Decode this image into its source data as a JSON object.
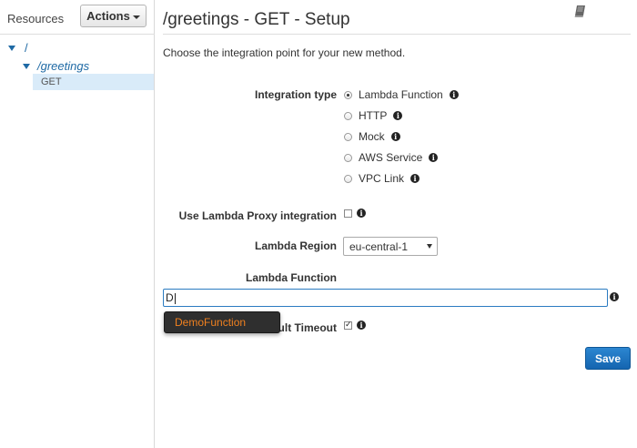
{
  "sidebar": {
    "resources_label": "Resources",
    "actions_label": "Actions",
    "tree": {
      "root": "/",
      "child": "/greetings",
      "method": "GET"
    }
  },
  "header": {
    "title": "/greetings - GET - Setup"
  },
  "intro_text": "Choose the integration point for your new method.",
  "integration_type": {
    "label": "Integration type",
    "options": [
      {
        "label": "Lambda Function",
        "selected": true
      },
      {
        "label": "HTTP",
        "selected": false
      },
      {
        "label": "Mock",
        "selected": false
      },
      {
        "label": "AWS Service",
        "selected": false
      },
      {
        "label": "VPC Link",
        "selected": false
      }
    ]
  },
  "proxy": {
    "label": "Use Lambda Proxy integration",
    "checked": false
  },
  "region": {
    "label": "Lambda Region",
    "value": "eu-central-1"
  },
  "lambda_function": {
    "label": "Lambda Function",
    "value": "D",
    "suggestion": "DemoFunction"
  },
  "timeout": {
    "label_visible": "ult Timeout",
    "checked": true
  },
  "save_label": "Save",
  "colors": {
    "link_blue": "#1f6aa5",
    "selected_bg": "#d9ebf9",
    "primary_button": "#1565b0",
    "suggestion_text": "#f0801f",
    "dropdown_bg": "#2f2f2f"
  }
}
